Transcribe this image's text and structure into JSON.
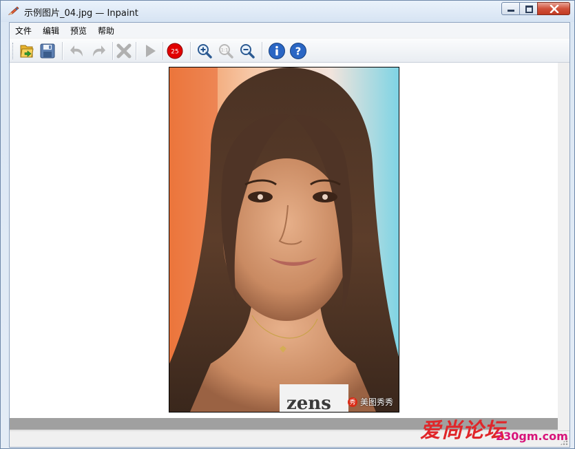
{
  "window": {
    "title": "示例图片_04.jpg — Inpaint",
    "app_icon": "inpaint-pencil-icon"
  },
  "menu": {
    "items": [
      "文件",
      "编辑",
      "预览",
      "帮助"
    ]
  },
  "toolbar": {
    "buttons": [
      {
        "name": "open-icon"
      },
      {
        "name": "save-icon"
      },
      {
        "name": "undo-icon"
      },
      {
        "name": "redo-icon"
      },
      {
        "name": "clear-icon"
      },
      {
        "name": "run-icon"
      },
      {
        "name": "marker-size-icon",
        "value": "25"
      },
      {
        "name": "zoom-in-icon"
      },
      {
        "name": "zoom-actual-icon",
        "value": "1:1"
      },
      {
        "name": "zoom-out-icon"
      },
      {
        "name": "info-icon"
      },
      {
        "name": "help-icon"
      }
    ]
  },
  "image": {
    "watermark_badge": "秀",
    "watermark_text": "美图秀秀",
    "shirt_text": "zens"
  },
  "overlay": {
    "forum_name": "爱尚论坛",
    "forum_url": "230gm.com"
  },
  "colors": {
    "titlebar": "#d7e4f3",
    "close_button": "#c94a33",
    "canvas_bg": "#ffffff",
    "hscroll": "#a0a0a0",
    "marker_badge": "#e10000"
  }
}
